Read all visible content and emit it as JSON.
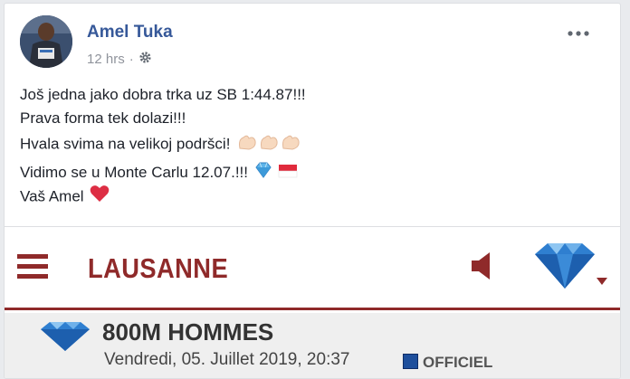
{
  "post": {
    "author": "Amel Tuka",
    "time": "12 hrs",
    "separator": "·",
    "privacy_icon": "gear-icon",
    "more_icon": "more-dots-icon",
    "lines": [
      "Još jedna jako dobra trka uz SB 1:44.87!!!",
      "Prava forma tek dolazi!!!",
      "Hvala svima na velikoj podršci!",
      "Vidimo se u Monte Carlu 12.07.!!!",
      "Vaš Amel"
    ],
    "emojis": [
      "flexed-biceps",
      "gem-stone",
      "monaco-flag",
      "red-heart"
    ]
  },
  "link_preview": {
    "city": "LAUSANNE",
    "brand_color": "#8f2a2a",
    "event_title": "800M HOMMES",
    "event_date": "Vendredi, 05. Juillet 2019, 20:37",
    "official_label": "OFFICIEL",
    "icons": [
      "menu-icon",
      "speaker-icon",
      "diamond-logo-icon"
    ]
  }
}
